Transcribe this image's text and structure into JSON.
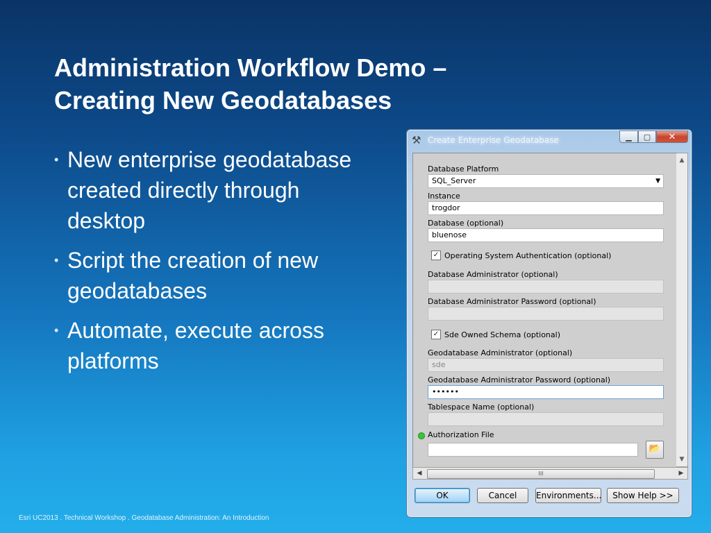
{
  "slide": {
    "title_line1": "Administration Workflow Demo –",
    "title_line2": "Creating New Geodatabases",
    "bullets": [
      "New enterprise geodatabase created directly through desktop",
      "Script the creation of new geodatabases",
      "Automate, execute across platforms"
    ],
    "footer": "Esri UC2013 . Technical Workshop . Geodatabase Administration: An Introduction"
  },
  "dialog": {
    "title": "Create Enterprise Geodatabase",
    "app_icon": "hammer-icon",
    "fields": {
      "platform_label": "Database Platform",
      "platform_value": "SQL_Server",
      "instance_label": "Instance",
      "instance_value": "trogdor",
      "database_label": "Database (optional)",
      "database_value": "bluenose",
      "os_auth_label": "Operating System Authentication (optional)",
      "db_admin_label": "Database Administrator (optional)",
      "db_admin_value": "",
      "db_admin_pw_label": "Database Administrator Password (optional)",
      "db_admin_pw_value": "",
      "sde_schema_label": "Sde Owned Schema (optional)",
      "gdb_admin_label": "Geodatabase Administrator (optional)",
      "gdb_admin_value": "sde",
      "gdb_admin_pw_label": "Geodatabase Administrator Password (optional)",
      "gdb_admin_pw_value": "••••••",
      "tablespace_label": "Tablespace Name (optional)",
      "tablespace_value": "",
      "auth_file_label": "Authorization File",
      "auth_file_value": ""
    },
    "checks": {
      "os_auth": "✓",
      "sde_schema": "✓"
    },
    "scroll_thumb_glyph": "III",
    "buttons": {
      "ok": "OK",
      "cancel": "Cancel",
      "environments": "Environments...",
      "show_help": "Show Help >>"
    },
    "colors": {
      "ok_accent": "#61b4ea",
      "close_red": "#c9452c",
      "required_dot": "#39c639"
    }
  }
}
